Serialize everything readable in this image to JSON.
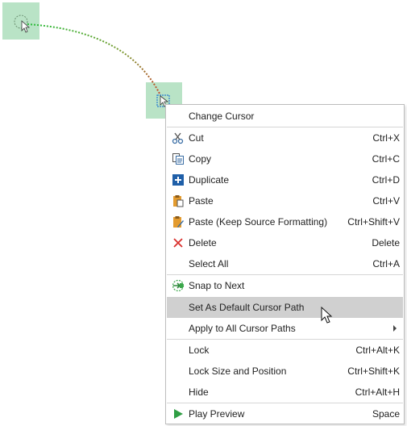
{
  "canvas": {
    "path_start_color": "#2bbd3c",
    "path_end_color": "#c8452d",
    "handle_color": "#b9e3c6",
    "icons": [
      "cursor-start-icon",
      "cursor-end-icon",
      "pointer-icon"
    ]
  },
  "menu": {
    "header": "Change Cursor",
    "groups": [
      [
        {
          "name": "cut",
          "label": "Cut",
          "shortcut": "Ctrl+X",
          "icon": "scissors-icon"
        },
        {
          "name": "copy",
          "label": "Copy",
          "shortcut": "Ctrl+C",
          "icon": "copy-icon"
        },
        {
          "name": "duplicate",
          "label": "Duplicate",
          "shortcut": "Ctrl+D",
          "icon": "duplicate-icon"
        },
        {
          "name": "paste",
          "label": "Paste",
          "shortcut": "Ctrl+V",
          "icon": "paste-icon"
        },
        {
          "name": "paste-keep-source",
          "label": "Paste (Keep Source Formatting)",
          "shortcut": "Ctrl+Shift+V",
          "icon": "paste-formatting-icon"
        },
        {
          "name": "delete",
          "label": "Delete",
          "shortcut": "Delete",
          "icon": "delete-x-icon"
        },
        {
          "name": "select-all",
          "label": "Select All",
          "shortcut": "Ctrl+A",
          "icon": ""
        }
      ],
      [
        {
          "name": "snap-to-next",
          "label": "Snap to Next",
          "shortcut": "",
          "icon": "snap-arrow-icon"
        },
        {
          "name": "set-default-cursor-path",
          "label": "Set As Default Cursor Path",
          "shortcut": "",
          "icon": "",
          "highlighted": true
        },
        {
          "name": "apply-to-all-cursor-paths",
          "label": "Apply to All Cursor Paths",
          "shortcut": "",
          "icon": "",
          "submenu": true
        }
      ],
      [
        {
          "name": "lock",
          "label": "Lock",
          "shortcut": "Ctrl+Alt+K",
          "icon": ""
        },
        {
          "name": "lock-size-position",
          "label": "Lock Size and Position",
          "shortcut": "Ctrl+Shift+K",
          "icon": ""
        },
        {
          "name": "hide",
          "label": "Hide",
          "shortcut": "Ctrl+Alt+H",
          "icon": ""
        }
      ],
      [
        {
          "name": "play-preview",
          "label": "Play Preview",
          "shortcut": "Space",
          "icon": "play-icon"
        }
      ]
    ]
  }
}
